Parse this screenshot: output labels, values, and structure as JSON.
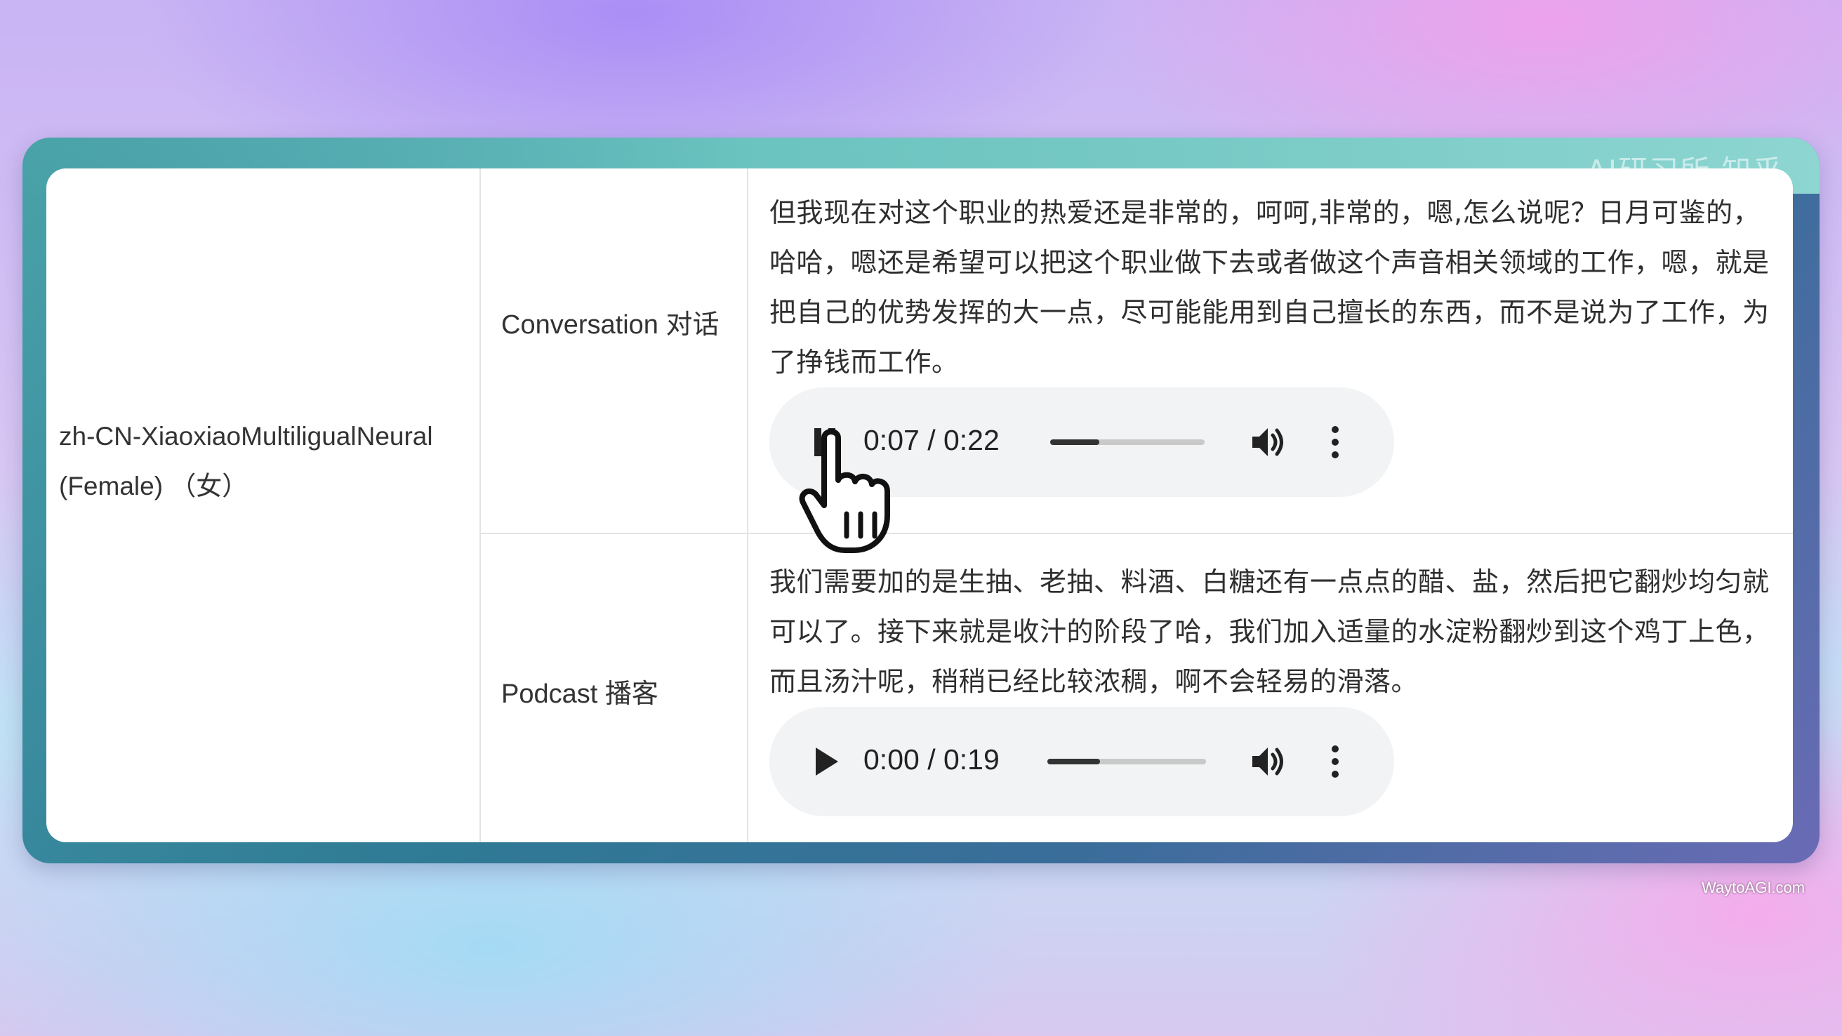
{
  "table": {
    "voice_name": "zh-CN-XiaoxiaoMultiligualNeural (Female) （女）",
    "rows": [
      {
        "style": "Conversation 对话",
        "text": "但我现在对这个职业的热爱还是非常的，呵呵,非常的，嗯,怎么说呢？日月可鉴的，哈哈，嗯还是希望可以把这个职业做下去或者做这个声音相关领域的工作，嗯，就是把自己的优势发挥的大一点，尽可能能用到自己擅长的东西，而不是说为了工作，为了挣钱而工作。",
        "player": {
          "state": "playing",
          "button_icon": "pause-icon",
          "time": "0:07 / 0:22",
          "progress": 0.32
        }
      },
      {
        "style": "Podcast 播客",
        "text": "我们需要加的是生抽、老抽、料酒、白糖还有一点点的醋、盐，然后把它翻炒均匀就可以了。接下来就是收汁的阶段了哈，我们加入适量的水淀粉翻炒到这个鸡丁上色，而且汤汁呢，稍稍已经比较浓稠，啊不会轻易的滑落。",
        "player": {
          "state": "paused",
          "button_icon": "play-icon",
          "time": "0:00 / 0:19",
          "progress": 0.33
        }
      }
    ]
  },
  "watermarks": {
    "top": "AI研习所 知乎",
    "bottom": "WaytoAGI.com"
  },
  "colors": {
    "card_bg": "#ffffff",
    "player_bg": "#f1f3f4",
    "text": "#2f2f2f",
    "grid_line": "#e3e3e3"
  }
}
